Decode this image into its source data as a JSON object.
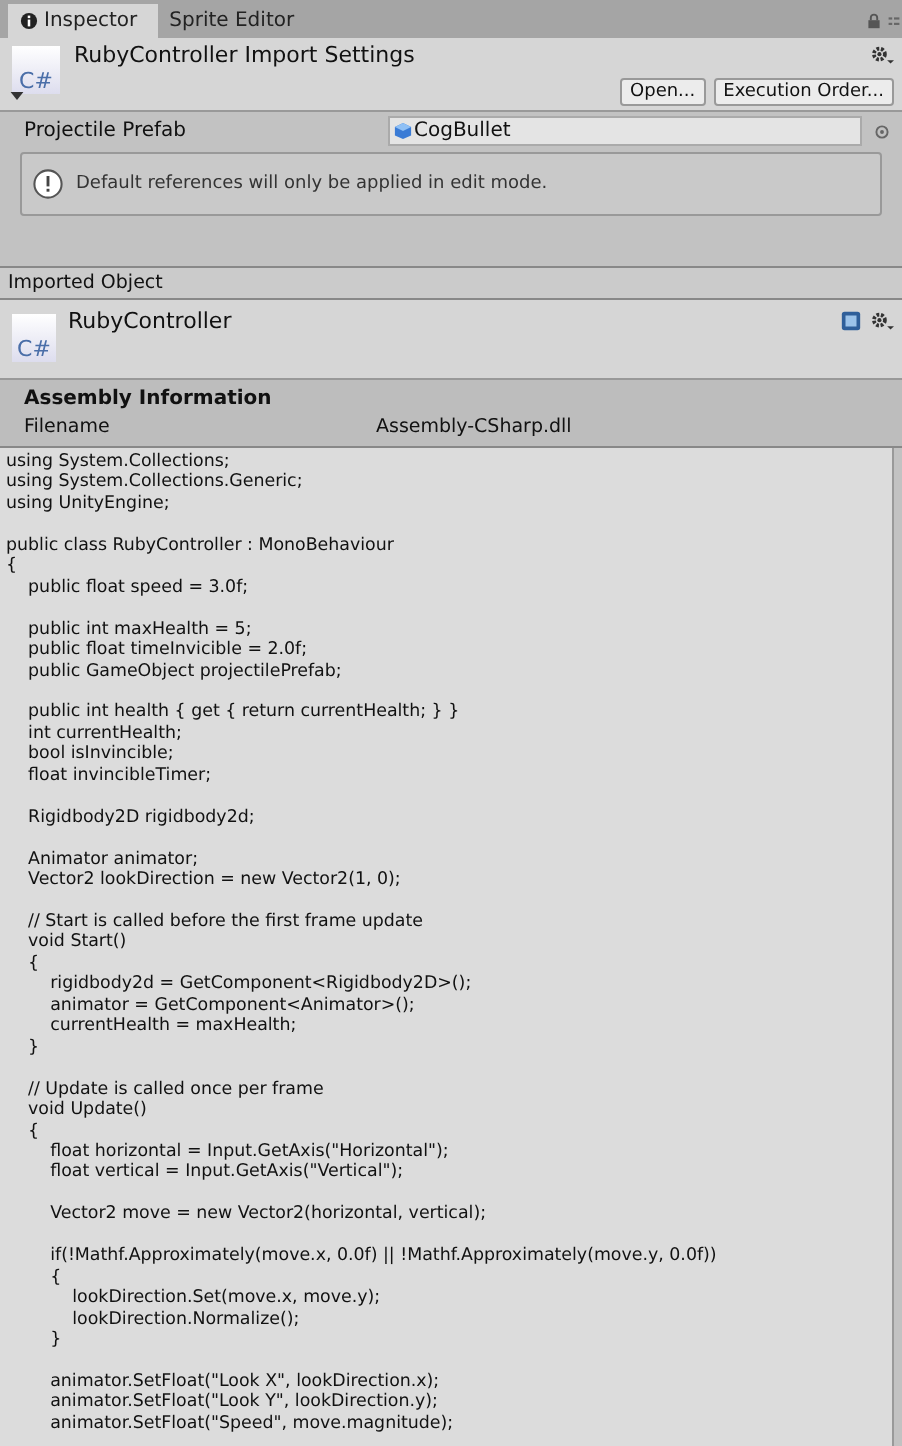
{
  "tabs": [
    {
      "label": "Inspector",
      "selected": true
    },
    {
      "label": "Sprite Editor",
      "selected": false
    }
  ],
  "import_settings": {
    "title": "RubyController Import Settings",
    "icon_text": "C#",
    "buttons": [
      "Open...",
      "Execution Order..."
    ]
  },
  "fields": [
    {
      "label": "Projectile Prefab",
      "value": "CogBullet"
    }
  ],
  "help_box": {
    "message": "Default references will only be applied in edit mode."
  },
  "imported_object": {
    "section_title": "Imported Object",
    "name": "RubyController",
    "icon_text": "C#"
  },
  "assembly_information": {
    "title": "Assembly Information",
    "rows": [
      {
        "label": "Filename",
        "value": "Assembly-CSharp.dll"
      }
    ]
  },
  "source_code": "using System.Collections;\nusing System.Collections.Generic;\nusing UnityEngine;\n\npublic class RubyController : MonoBehaviour\n{\n    public float speed = 3.0f;\n\n    public int maxHealth = 5;\n    public float timeInvicible = 2.0f;\n    public GameObject projectilePrefab;\n\n    public int health { get { return currentHealth; } }\n    int currentHealth;\n    bool isInvincible;\n    float invincibleTimer;\n\n    Rigidbody2D rigidbody2d;\n\n    Animator animator;\n    Vector2 lookDirection = new Vector2(1, 0);\n\n    // Start is called before the first frame update\n    void Start()\n    {\n        rigidbody2d = GetComponent<Rigidbody2D>();\n        animator = GetComponent<Animator>();\n        currentHealth = maxHealth;\n    }\n\n    // Update is called once per frame\n    void Update()\n    {\n        float horizontal = Input.GetAxis(\"Horizontal\");\n        float vertical = Input.GetAxis(\"Vertical\");\n\n        Vector2 move = new Vector2(horizontal, vertical);\n\n        if(!Mathf.Approximately(move.x, 0.0f) || !Mathf.Approximately(move.y, 0.0f))\n        {\n            lookDirection.Set(move.x, move.y);\n            lookDirection.Normalize();\n        }\n\n        animator.SetFloat(\"Look X\", lookDirection.x);\n        animator.SetFloat(\"Look Y\", lookDirection.y);\n        animator.SetFloat(\"Speed\", move.magnitude);"
}
